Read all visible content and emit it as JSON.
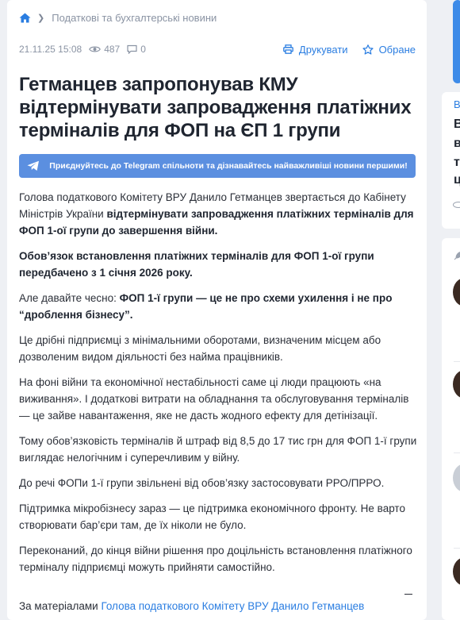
{
  "breadcrumb": {
    "home_icon": "home-icon",
    "section": "Податкові та бухгалтерські новини"
  },
  "meta": {
    "date": "21.11.25 15:08",
    "views": "487",
    "comments": "0",
    "print_label": "Друкувати",
    "favorite_label": "Обране"
  },
  "article": {
    "title": "Гетманцев запропонував КМУ відтермінувати запровадження платіжних терміналів для ФОП на ЄП 1 групи",
    "telegram_cta": "Приєднуйтесь до Telegram спільноти та дізнавайтесь найважливіші новини першими!",
    "p1_a": "Голова податкового Комітету ВРУ Данило Гетманцев звертається до Кабінету Міністрів України ",
    "p1_b": "відтермінувати запровадження платіжних терміналів для ФОП 1-ої групи до завершення війни.",
    "p2": "Обов’язок встановлення платіжних терміналів для ФОП 1-ої групи передбачено з 1 січня 2026 року.",
    "p3_a": "Але давайте чесно: ",
    "p3_b": "ФОП 1-ї групи — це не про схеми ухилення і не про “дроблення бізнесу”.",
    "p4": "Це дрібні підприємці з мінімальними оборотами, визначеним місцем або дозволеним видом діяльності без найма працівників.",
    "p5": "На фоні війни та економічної нестабільності саме ці люди працюють «на виживання». І додаткові витрати на обладнання та обслуговування терміналів — це зайве навантаження, яке не дасть жодного ефекту для детінізації.",
    "p6": "Тому обов’язковість терміналів й штраф від 8,5 до 17 тис грн для ФОП 1-ї групи виглядає нелогічним і суперечливим у війну.",
    "p7": "До речі ФОПи 1-ї групи звільнені від обов’язку застосовувати РРО/ПРРО.",
    "p8": "Підтримка мікробізнесу зараз — це підтримка економічного фронту. Не варто створювати бар’єри там, де їх ніколи не було.",
    "p9": "Переконаний, до кінця війни рішення про доцільність встановлення платіжного терміналу підприємці можуть прийняти самостійно.",
    "source_label": "За матеріалами",
    "source_link": "Голова податкового Комітету ВРУ Данило Гетманцев"
  },
  "sidebar": {
    "c1_l1": "В",
    "c1_l2": "В",
    "c1_l3": "в",
    "c1_l4": "т",
    "c1_l5": "ц"
  },
  "colors": {
    "accent": "#2a7de1",
    "telegram_button": "#5b8fe0",
    "background": "#eef0f4"
  }
}
